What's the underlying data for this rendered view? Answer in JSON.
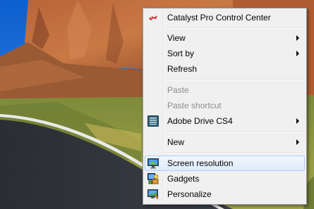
{
  "context_menu": {
    "items": [
      {
        "label": "Catalyst Pro Control Center",
        "icon": "catalyst-icon"
      },
      {
        "label": "View",
        "submenu": true
      },
      {
        "label": "Sort by",
        "submenu": true
      },
      {
        "label": "Refresh"
      },
      {
        "label": "Paste",
        "disabled": true
      },
      {
        "label": "Paste shortcut",
        "disabled": true
      },
      {
        "label": "Adobe Drive CS4",
        "icon": "adobe-drive-icon",
        "submenu": true
      },
      {
        "label": "New",
        "submenu": true
      },
      {
        "label": "Screen resolution",
        "icon": "screen-resolution-icon",
        "highlighted": true
      },
      {
        "label": "Gadgets",
        "icon": "gadgets-icon"
      },
      {
        "label": "Personalize",
        "icon": "personalize-icon"
      }
    ]
  },
  "colors": {
    "menu_background": "#f0f0f0",
    "highlight_border": "#aecff7",
    "disabled_text": "#8d8d8d",
    "sky": "#1a6fd6"
  }
}
